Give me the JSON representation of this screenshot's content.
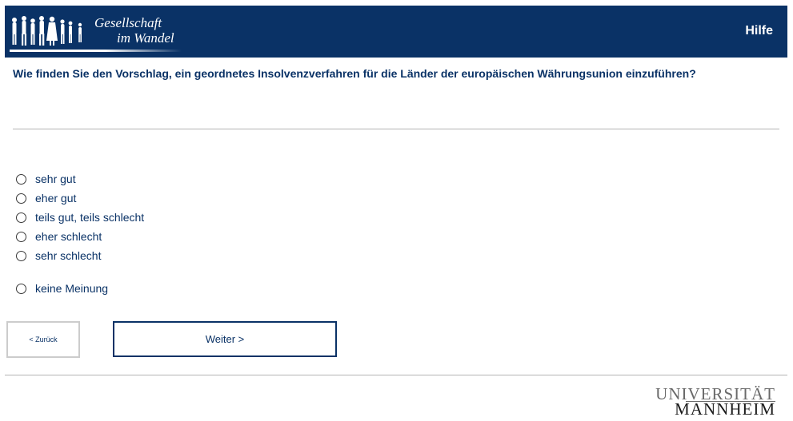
{
  "header": {
    "logo_line1": "Gesellschaft",
    "logo_line2": "im Wandel",
    "help_label": "Hilfe",
    "background_color": "#0a3266"
  },
  "question": "Wie finden Sie den Vorschlag, ein geordnetes Insolvenzverfahren für die Länder der europäischen Währungsunion einzuführen?",
  "options": [
    {
      "label": "sehr gut",
      "selected": false
    },
    {
      "label": "eher gut",
      "selected": false
    },
    {
      "label": "teils gut, teils schlecht",
      "selected": false
    },
    {
      "label": "eher schlecht",
      "selected": false
    },
    {
      "label": "sehr schlecht",
      "selected": false
    },
    {
      "label": "keine Meinung",
      "selected": false
    }
  ],
  "navigation": {
    "back_label": "< Zurück",
    "next_label": "Weiter >"
  },
  "footer": {
    "university_line1": "UNIVERSITÄT",
    "university_line2": "MANNHEIM"
  }
}
